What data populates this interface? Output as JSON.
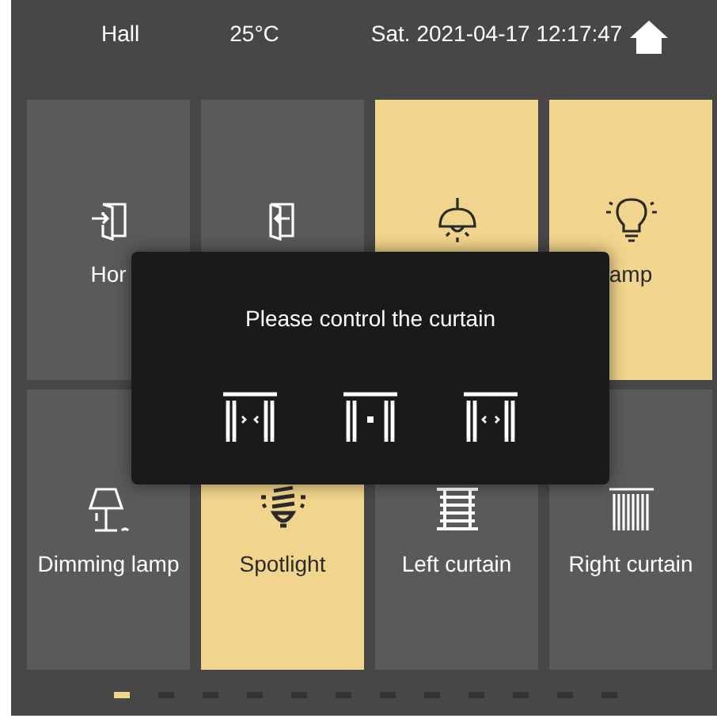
{
  "header": {
    "room": "Hall",
    "temperature": "25°C",
    "datetime": "Sat. 2021-04-17 12:17:47"
  },
  "tiles": [
    {
      "label": "Hor",
      "kind": "door-in",
      "on": false
    },
    {
      "kind": "door-out",
      "on": false
    },
    {
      "kind": "chandelier",
      "on": true
    },
    {
      "label": "amp",
      "kind": "bulb",
      "on": true
    },
    {
      "label": "Dimming lamp",
      "kind": "table-lamp",
      "on": false
    },
    {
      "label": "Spotlight",
      "kind": "spotlight",
      "on": true
    },
    {
      "label": "Left curtain",
      "kind": "blinds",
      "on": false
    },
    {
      "label": "Right curtain",
      "kind": "curtain",
      "on": false
    }
  ],
  "dialog": {
    "title": "Please control the curtain",
    "buttons": [
      {
        "kind": "close"
      },
      {
        "kind": "stop"
      },
      {
        "kind": "open"
      }
    ]
  },
  "pager": [
    {
      "selected": true
    },
    {
      "selected": false
    },
    {
      "selected": false
    },
    {
      "selected": false
    },
    {
      "selected": false
    },
    {
      "selected": false
    },
    {
      "selected": false
    },
    {
      "selected": false
    },
    {
      "selected": false
    },
    {
      "selected": false
    },
    {
      "selected": false
    },
    {
      "selected": false
    }
  ]
}
